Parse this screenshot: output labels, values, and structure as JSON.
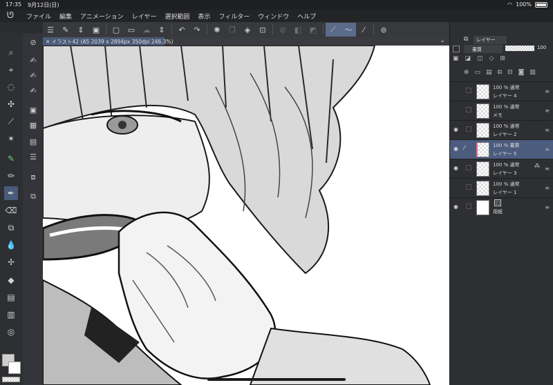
{
  "status": {
    "time": "17:35",
    "date": "9月12日(日)",
    "battery": "100%"
  },
  "menu": {
    "items": [
      "ファイル",
      "編集",
      "アニメーション",
      "レイヤー",
      "選択範囲",
      "表示",
      "フィルター",
      "ウィンドウ",
      "ヘルプ"
    ]
  },
  "document": {
    "tab_label": "✕ イラスト42 (A5 2039 x 2894px 350dpi 246.3%)"
  },
  "layer_panel": {
    "tab_label": "レイヤー",
    "blend_mode": "乗算",
    "opacity": "100",
    "layers": [
      {
        "percent": "100 % 通常",
        "name": "レイヤー 4",
        "visible": false,
        "selected": false,
        "paper": false
      },
      {
        "percent": "100 % 通常",
        "name": "メモ",
        "visible": false,
        "selected": false,
        "paper": false
      },
      {
        "percent": "100 % 通常",
        "name": "レイヤー 2",
        "visible": true,
        "selected": false,
        "paper": false
      },
      {
        "percent": "100 % 乗算",
        "name": "レイヤー 5",
        "visible": true,
        "selected": true,
        "paper": false
      },
      {
        "percent": "100 % 通常",
        "name": "レイヤー 3",
        "visible": true,
        "selected": false,
        "paper": false
      },
      {
        "percent": "100 % 通常",
        "name": "レイヤー 1",
        "visible": false,
        "selected": false,
        "paper": false
      },
      {
        "percent": "",
        "name": "用紙",
        "visible": true,
        "selected": false,
        "paper": true
      }
    ]
  },
  "colors": {
    "selection": "#4c5c7e",
    "panel_bg": "#2e2f32",
    "accent": "#5b6b8a"
  }
}
